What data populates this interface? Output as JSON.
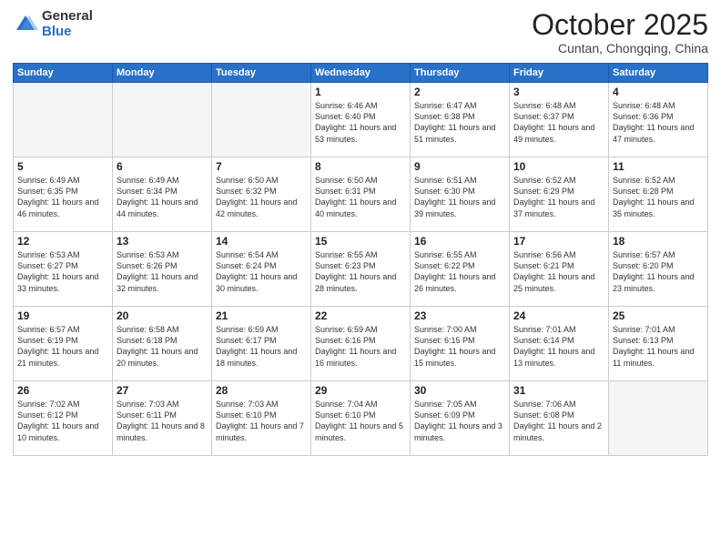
{
  "header": {
    "logo_general": "General",
    "logo_blue": "Blue",
    "month_title": "October 2025",
    "location": "Cuntan, Chongqing, China"
  },
  "days_of_week": [
    "Sunday",
    "Monday",
    "Tuesday",
    "Wednesday",
    "Thursday",
    "Friday",
    "Saturday"
  ],
  "weeks": [
    [
      {
        "day": "",
        "info": ""
      },
      {
        "day": "",
        "info": ""
      },
      {
        "day": "",
        "info": ""
      },
      {
        "day": "1",
        "info": "Sunrise: 6:46 AM\nSunset: 6:40 PM\nDaylight: 11 hours\nand 53 minutes."
      },
      {
        "day": "2",
        "info": "Sunrise: 6:47 AM\nSunset: 6:38 PM\nDaylight: 11 hours\nand 51 minutes."
      },
      {
        "day": "3",
        "info": "Sunrise: 6:48 AM\nSunset: 6:37 PM\nDaylight: 11 hours\nand 49 minutes."
      },
      {
        "day": "4",
        "info": "Sunrise: 6:48 AM\nSunset: 6:36 PM\nDaylight: 11 hours\nand 47 minutes."
      }
    ],
    [
      {
        "day": "5",
        "info": "Sunrise: 6:49 AM\nSunset: 6:35 PM\nDaylight: 11 hours\nand 46 minutes."
      },
      {
        "day": "6",
        "info": "Sunrise: 6:49 AM\nSunset: 6:34 PM\nDaylight: 11 hours\nand 44 minutes."
      },
      {
        "day": "7",
        "info": "Sunrise: 6:50 AM\nSunset: 6:32 PM\nDaylight: 11 hours\nand 42 minutes."
      },
      {
        "day": "8",
        "info": "Sunrise: 6:50 AM\nSunset: 6:31 PM\nDaylight: 11 hours\nand 40 minutes."
      },
      {
        "day": "9",
        "info": "Sunrise: 6:51 AM\nSunset: 6:30 PM\nDaylight: 11 hours\nand 39 minutes."
      },
      {
        "day": "10",
        "info": "Sunrise: 6:52 AM\nSunset: 6:29 PM\nDaylight: 11 hours\nand 37 minutes."
      },
      {
        "day": "11",
        "info": "Sunrise: 6:52 AM\nSunset: 6:28 PM\nDaylight: 11 hours\nand 35 minutes."
      }
    ],
    [
      {
        "day": "12",
        "info": "Sunrise: 6:53 AM\nSunset: 6:27 PM\nDaylight: 11 hours\nand 33 minutes."
      },
      {
        "day": "13",
        "info": "Sunrise: 6:53 AM\nSunset: 6:26 PM\nDaylight: 11 hours\nand 32 minutes."
      },
      {
        "day": "14",
        "info": "Sunrise: 6:54 AM\nSunset: 6:24 PM\nDaylight: 11 hours\nand 30 minutes."
      },
      {
        "day": "15",
        "info": "Sunrise: 6:55 AM\nSunset: 6:23 PM\nDaylight: 11 hours\nand 28 minutes."
      },
      {
        "day": "16",
        "info": "Sunrise: 6:55 AM\nSunset: 6:22 PM\nDaylight: 11 hours\nand 26 minutes."
      },
      {
        "day": "17",
        "info": "Sunrise: 6:56 AM\nSunset: 6:21 PM\nDaylight: 11 hours\nand 25 minutes."
      },
      {
        "day": "18",
        "info": "Sunrise: 6:57 AM\nSunset: 6:20 PM\nDaylight: 11 hours\nand 23 minutes."
      }
    ],
    [
      {
        "day": "19",
        "info": "Sunrise: 6:57 AM\nSunset: 6:19 PM\nDaylight: 11 hours\nand 21 minutes."
      },
      {
        "day": "20",
        "info": "Sunrise: 6:58 AM\nSunset: 6:18 PM\nDaylight: 11 hours\nand 20 minutes."
      },
      {
        "day": "21",
        "info": "Sunrise: 6:59 AM\nSunset: 6:17 PM\nDaylight: 11 hours\nand 18 minutes."
      },
      {
        "day": "22",
        "info": "Sunrise: 6:59 AM\nSunset: 6:16 PM\nDaylight: 11 hours\nand 16 minutes."
      },
      {
        "day": "23",
        "info": "Sunrise: 7:00 AM\nSunset: 6:15 PM\nDaylight: 11 hours\nand 15 minutes."
      },
      {
        "day": "24",
        "info": "Sunrise: 7:01 AM\nSunset: 6:14 PM\nDaylight: 11 hours\nand 13 minutes."
      },
      {
        "day": "25",
        "info": "Sunrise: 7:01 AM\nSunset: 6:13 PM\nDaylight: 11 hours\nand 11 minutes."
      }
    ],
    [
      {
        "day": "26",
        "info": "Sunrise: 7:02 AM\nSunset: 6:12 PM\nDaylight: 11 hours\nand 10 minutes."
      },
      {
        "day": "27",
        "info": "Sunrise: 7:03 AM\nSunset: 6:11 PM\nDaylight: 11 hours\nand 8 minutes."
      },
      {
        "day": "28",
        "info": "Sunrise: 7:03 AM\nSunset: 6:10 PM\nDaylight: 11 hours\nand 7 minutes."
      },
      {
        "day": "29",
        "info": "Sunrise: 7:04 AM\nSunset: 6:10 PM\nDaylight: 11 hours\nand 5 minutes."
      },
      {
        "day": "30",
        "info": "Sunrise: 7:05 AM\nSunset: 6:09 PM\nDaylight: 11 hours\nand 3 minutes."
      },
      {
        "day": "31",
        "info": "Sunrise: 7:06 AM\nSunset: 6:08 PM\nDaylight: 11 hours\nand 2 minutes."
      },
      {
        "day": "",
        "info": ""
      }
    ]
  ]
}
